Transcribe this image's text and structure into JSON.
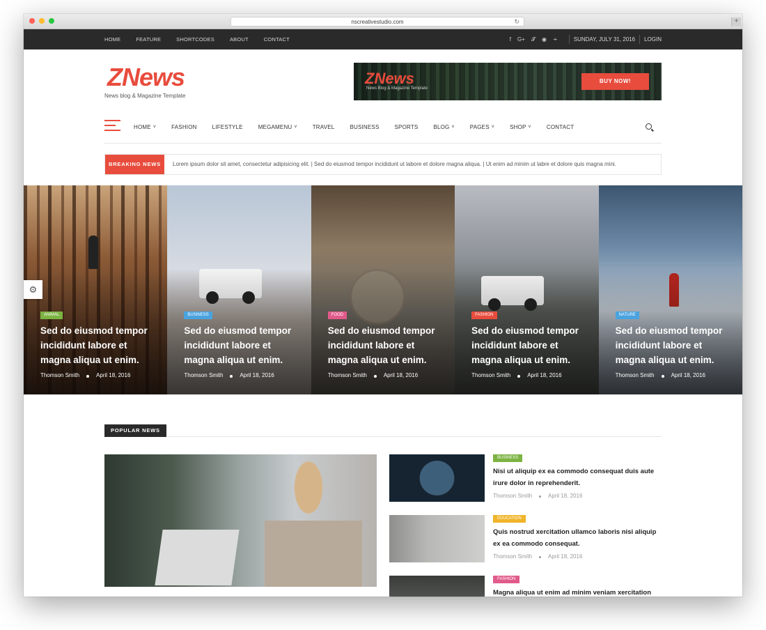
{
  "browser": {
    "url": "nscreativestudio.com",
    "reload_icon": "reload-icon",
    "newtab": "+"
  },
  "topbar": {
    "nav": [
      "HOME",
      "FEATURE",
      "SHORTCODES",
      "ABOUT",
      "CONTACT"
    ],
    "social": [
      "f",
      "G+",
      "t",
      "p",
      "rss"
    ],
    "date": "SUNDAY, JULY 31, 2016",
    "login": "LOGIN"
  },
  "header": {
    "logo": "ZNews",
    "tagline": "News blog & Magazine Template",
    "banner": {
      "logo": "ZNews",
      "sub": "News Blog & Magazine Template",
      "button": "BUY NOW!"
    }
  },
  "mainnav": {
    "items": [
      "HOME",
      "FASHION",
      "LIFESTYLE",
      "MEGAMENU",
      "TRAVEL",
      "BUSINESS",
      "SPORTS",
      "BLOG",
      "PAGES",
      "SHOP",
      "CONTACT"
    ],
    "dropdown_marks": [
      true,
      false,
      false,
      true,
      false,
      false,
      false,
      true,
      true,
      true,
      false
    ]
  },
  "breaking": {
    "label": "BREAKING NEWS",
    "text": "Lorem ipsum dolor sit amet, consectetur adipisicing elit. | Sed do eiusmod tempor incididunt ut labore et dolore magna aliqua. | Ut enim ad minim ut labre et dolore quis magna mini."
  },
  "slider": [
    {
      "badge": "ANIMAL",
      "badge_color": "#7cb342",
      "title": "Sed do eiusmod tempor incididunt labore et magna aliqua ut enim.",
      "author": "Thomson Smith",
      "date": "April 18, 2016"
    },
    {
      "badge": "BUSINESS",
      "badge_color": "#4aa3df",
      "title": "Sed do eiusmod tempor incididunt labore et magna aliqua ut enim.",
      "author": "Thomson Smith",
      "date": "April 18, 2016"
    },
    {
      "badge": "FOOD",
      "badge_color": "#e05a8a",
      "title": "Sed do eiusmod tempor incididunt labore et magna aliqua ut enim.",
      "author": "Thomson Smith",
      "date": "April 18, 2016"
    },
    {
      "badge": "FASHION",
      "badge_color": "#e84c3d",
      "title": "Sed do eiusmod tempor incididunt labore et magna aliqua ut enim.",
      "author": "Thomson Smith",
      "date": "April 18, 2016"
    },
    {
      "badge": "NATURE",
      "badge_color": "#4aa3df",
      "title": "Sed do eiusmod tempor incididunt labore et magna aliqua ut enim.",
      "author": "Thomson Smith",
      "date": "April 18, 2016"
    }
  ],
  "popular": {
    "label": "POPULAR NEWS",
    "items": [
      {
        "badge": "BUSINESS",
        "badge_color": "#7cb342",
        "title": "Nisi ut aliquip ex ea commodo consequat duis aute irure dolor in reprehenderit.",
        "author": "Thomson Smith",
        "date": "April 18, 2016"
      },
      {
        "badge": "EDUCATION",
        "badge_color": "#f0b429",
        "title": "Quis nostrud xercitation ullamco laboris nisi aliquip ex ea commodo consequat.",
        "author": "Thomson Smith",
        "date": "April 18, 2016"
      },
      {
        "badge": "FASHION",
        "badge_color": "#e05a8a",
        "title": "Magna aliqua ut enim ad minim veniam xercitation nisi",
        "author": "",
        "date": ""
      }
    ]
  },
  "colors": {
    "accent": "#e84c3d",
    "dark_bar": "#2a2a2a"
  }
}
